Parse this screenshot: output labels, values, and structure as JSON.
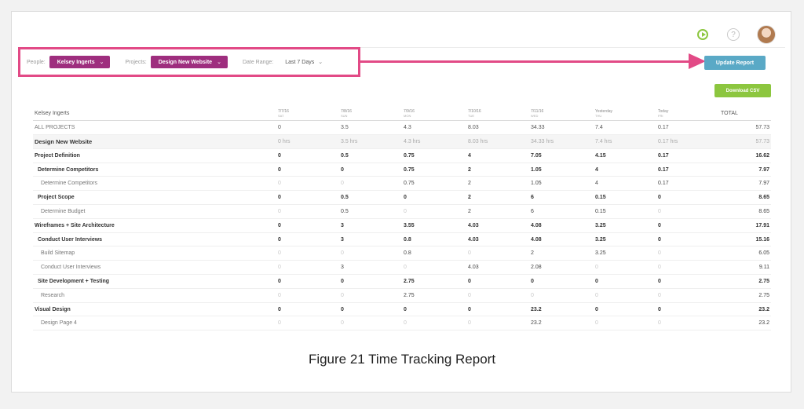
{
  "header": {
    "icons": [
      "timer-icon",
      "help-icon",
      "avatar"
    ]
  },
  "filters": {
    "people_label": "People:",
    "people_value": "Kelsey Ingerts",
    "projects_label": "Projects:",
    "projects_value": "Design New Website",
    "date_label": "Date Range:",
    "date_value": "Last 7 Days"
  },
  "buttons": {
    "update": "Update Report",
    "download": "Download CSV"
  },
  "table": {
    "name_header": "Kelsey Ingerts",
    "total_header": "TOTAL",
    "date_headers": [
      {
        "date": "7/7/16",
        "day": "SAT"
      },
      {
        "date": "7/8/16",
        "day": "SUN"
      },
      {
        "date": "7/9/16",
        "day": "MON"
      },
      {
        "date": "7/10/16",
        "day": "TUE"
      },
      {
        "date": "7/11/16",
        "day": "WED"
      },
      {
        "date": "Yesterday",
        "day": "THU"
      },
      {
        "date": "Today",
        "day": "FRI"
      }
    ],
    "rows": [
      {
        "name": "ALL PROJECTS",
        "style": "allproj",
        "cells": [
          "0",
          "3.5",
          "4.3",
          "8.03",
          "34.33",
          "7.4",
          "0.17"
        ],
        "total": "57.73"
      },
      {
        "name": "Design New Website",
        "style": "proj",
        "cells": [
          "0 hrs",
          "3.5 hrs",
          "4.3 hrs",
          "8.03 hrs",
          "34.33 hrs",
          "7.4 hrs",
          "0.17 hrs"
        ],
        "total": "57.73"
      },
      {
        "name": "Project Definition",
        "style": "bold",
        "cells": [
          "0",
          "0.5",
          "0.75",
          "4",
          "7.05",
          "4.15",
          "0.17"
        ],
        "total": "16.62"
      },
      {
        "name": "Determine Competitors",
        "style": "bold lvl1",
        "cells": [
          "0",
          "0",
          "0.75",
          "2",
          "1.05",
          "4",
          "0.17"
        ],
        "total": "7.97"
      },
      {
        "name": "Determine Competitors",
        "style": "lvl2",
        "cells": [
          "0",
          "0",
          "0.75",
          "2",
          "1.05",
          "4",
          "0.17"
        ],
        "total": "7.97"
      },
      {
        "name": "Project Scope",
        "style": "bold lvl1",
        "cells": [
          "0",
          "0.5",
          "0",
          "2",
          "6",
          "0.15",
          "0"
        ],
        "total": "8.65"
      },
      {
        "name": "Determine Budget",
        "style": "lvl2",
        "cells": [
          "0",
          "0.5",
          "0",
          "2",
          "6",
          "0.15",
          "0"
        ],
        "total": "8.65"
      },
      {
        "name": "Wireframes + Site Architecture",
        "style": "bold",
        "cells": [
          "0",
          "3",
          "3.55",
          "4.03",
          "4.08",
          "3.25",
          "0"
        ],
        "total": "17.91"
      },
      {
        "name": "Conduct User Interviews",
        "style": "bold lvl1",
        "cells": [
          "0",
          "3",
          "0.8",
          "4.03",
          "4.08",
          "3.25",
          "0"
        ],
        "total": "15.16"
      },
      {
        "name": "Build Sitemap",
        "style": "lvl2",
        "cells": [
          "0",
          "0",
          "0.8",
          "0",
          "2",
          "3.25",
          "0"
        ],
        "total": "6.05"
      },
      {
        "name": "Conduct User Interviews",
        "style": "lvl2",
        "cells": [
          "0",
          "3",
          "0",
          "4.03",
          "2.08",
          "0",
          "0"
        ],
        "total": "9.11"
      },
      {
        "name": "Site Development + Testing",
        "style": "bold lvl1",
        "cells": [
          "0",
          "0",
          "2.75",
          "0",
          "0",
          "0",
          "0"
        ],
        "total": "2.75"
      },
      {
        "name": "Research",
        "style": "lvl2",
        "cells": [
          "0",
          "0",
          "2.75",
          "0",
          "0",
          "0",
          "0"
        ],
        "total": "2.75"
      },
      {
        "name": "Visual Design",
        "style": "bold",
        "cells": [
          "0",
          "0",
          "0",
          "0",
          "23.2",
          "0",
          "0"
        ],
        "total": "23.2"
      },
      {
        "name": "Design Page 4",
        "style": "lvl2",
        "cells": [
          "0",
          "0",
          "0",
          "0",
          "23.2",
          "0",
          "0"
        ],
        "total": "23.2"
      }
    ]
  },
  "caption": "Figure 21 Time Tracking Report",
  "colors": {
    "highlight": "#e24a86",
    "pill": "#9e2e7e",
    "update_button": "#5aa9c6",
    "csv_button": "#8cc63f"
  }
}
